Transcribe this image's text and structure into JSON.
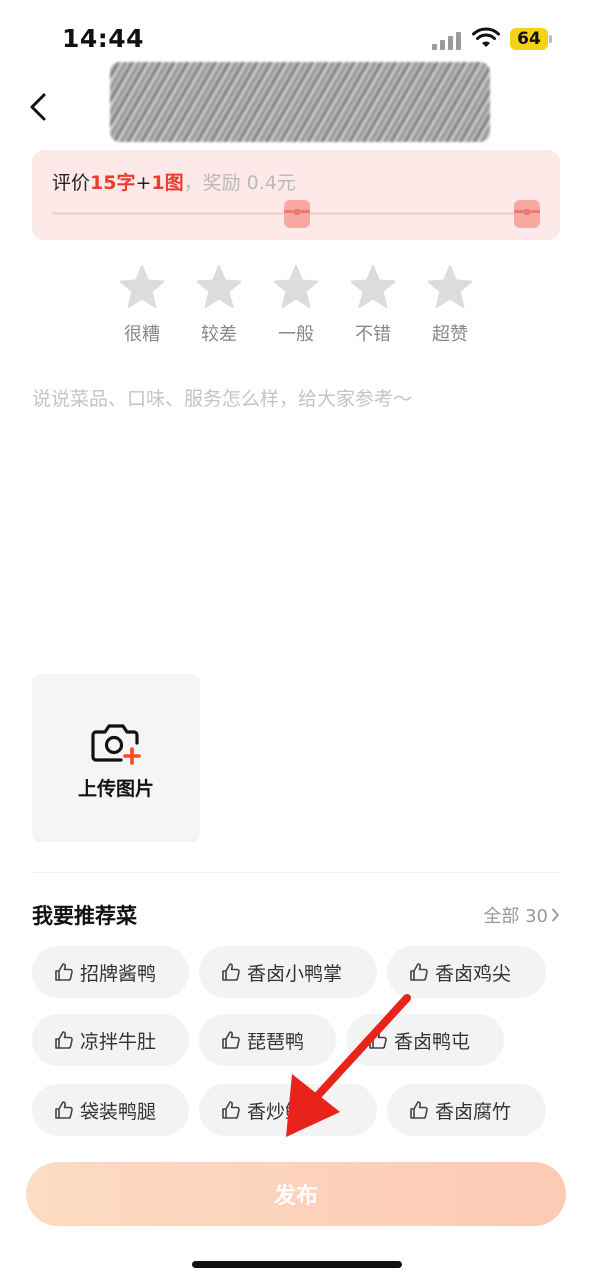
{
  "status_bar": {
    "time": "14:44",
    "battery": "64"
  },
  "header": {
    "shop_name": ""
  },
  "reward": {
    "prefix": "评价",
    "char_req": "15字",
    "plus": "+",
    "img_req": "1图",
    "suffix": "，奖励 0.4元"
  },
  "rating": {
    "labels": [
      "很糟",
      "较差",
      "一般",
      "不错",
      "超赞"
    ],
    "value": 0
  },
  "review": {
    "placeholder": "说说菜品、口味、服务怎么样，给大家参考～",
    "value": ""
  },
  "upload": {
    "label": "上传图片"
  },
  "recommend": {
    "title": "我要推荐菜",
    "all_label": "全部 30",
    "dishes": [
      "招牌酱鸭",
      "香卤小鸭掌",
      "香卤鸡尖",
      "凉拌牛肚",
      "琵琶鸭",
      "香卤鸭屯",
      "袋装鸭腿",
      "香炒鱿鱼",
      "香卤腐竹"
    ]
  },
  "publish": {
    "label": "发布"
  },
  "colors": {
    "accent": "#ee3b2f",
    "reward_bg": "#fde9e8",
    "publish_from": "#fcdcc2",
    "publish_to": "#fdc9b4",
    "star": "#d9d9d9",
    "chip_bg": "#f3f3f3"
  },
  "icons": {
    "back": "chevron-left-icon",
    "star": "star-icon",
    "camera": "camera-plus-icon",
    "thumb": "thumb-up-icon",
    "gift": "gift-icon"
  }
}
